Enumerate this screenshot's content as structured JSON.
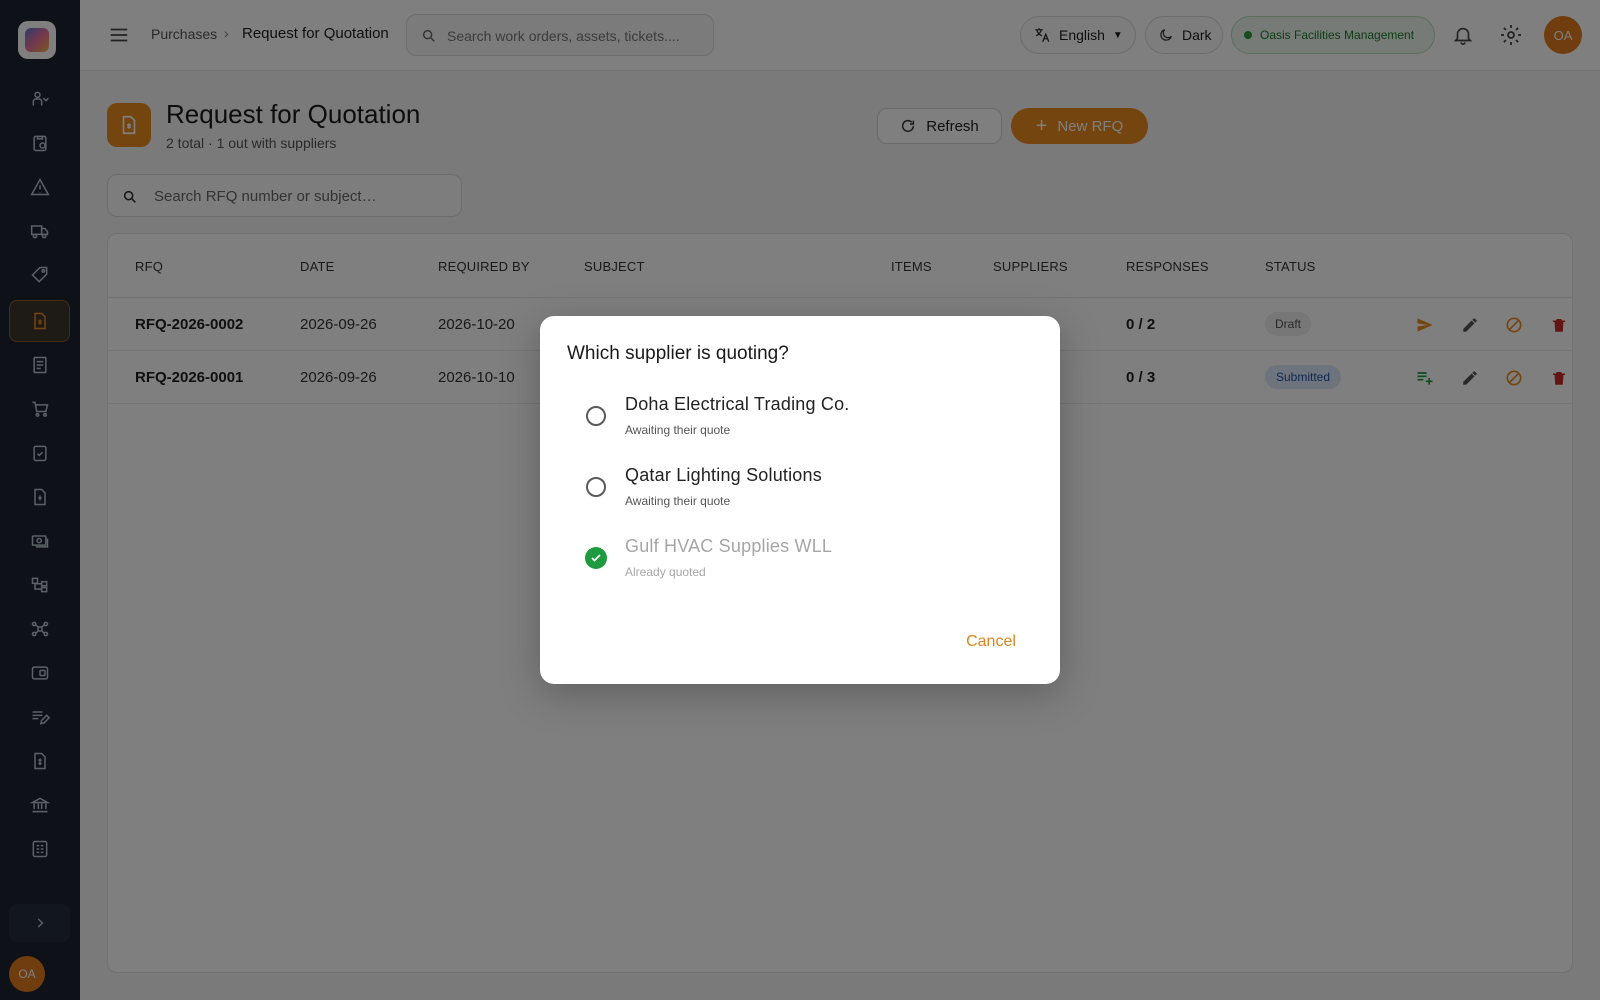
{
  "topbar": {
    "breadcrumb": [
      "Purchases",
      "Request for Quotation"
    ],
    "breadcrumb_separator": "›",
    "search_placeholder": "Search work orders, assets, tickets....",
    "language": "English",
    "theme_label": "Dark",
    "organization": "Oasis Facilities Management",
    "user_initials": "OA"
  },
  "page": {
    "title": "Request for Quotation",
    "subtitle": "2 total · 1 out with suppliers",
    "refresh_label": "Refresh",
    "new_label": "New RFQ",
    "new_icon": "+",
    "search_placeholder": "Search RFQ number or subject…"
  },
  "table": {
    "columns": [
      "RFQ",
      "DATE",
      "REQUIRED BY",
      "SUBJECT",
      "ITEMS",
      "SUPPLIERS",
      "RESPONSES",
      "STATUS"
    ],
    "rows": [
      {
        "rfq": "RFQ-2026-0002",
        "date": "2026-09-26",
        "required_by": "2026-10-20",
        "responses": "0 / 2",
        "status": "Draft"
      },
      {
        "rfq": "RFQ-2026-0001",
        "date": "2026-09-26",
        "required_by": "2026-10-10",
        "responses": "0 / 3",
        "status": "Submitted"
      }
    ]
  },
  "sidebar": {
    "user_initials": "OA",
    "icons": [
      "people-icon",
      "clipboard-icon",
      "warning-icon",
      "truck-icon",
      "tag-icon",
      "document-icon",
      "ledger-icon",
      "cart-icon",
      "checklist-icon",
      "invoice-icon",
      "cash-icon",
      "hierarchy-icon",
      "network-icon",
      "wallet-icon",
      "list-edit-icon",
      "bill-icon",
      "bank-icon",
      "calculator-icon"
    ]
  },
  "dialog": {
    "title": "Which supplier is quoting?",
    "options": [
      {
        "name": "Doha Electrical Trading Co.",
        "note": "Awaiting their quote",
        "state": "unselected"
      },
      {
        "name": "Qatar Lighting Solutions",
        "note": "Awaiting their quote",
        "state": "unselected"
      },
      {
        "name": "Gulf HVAC Supplies WLL",
        "note": "Already quoted",
        "state": "quoted"
      }
    ],
    "cancel_label": "Cancel"
  },
  "colors": {
    "accent": "#e98a1f",
    "sidebar_bg": "#1c2530",
    "success": "#1e9b3e",
    "danger": "#c62828",
    "status_submitted": "#2450a8"
  }
}
